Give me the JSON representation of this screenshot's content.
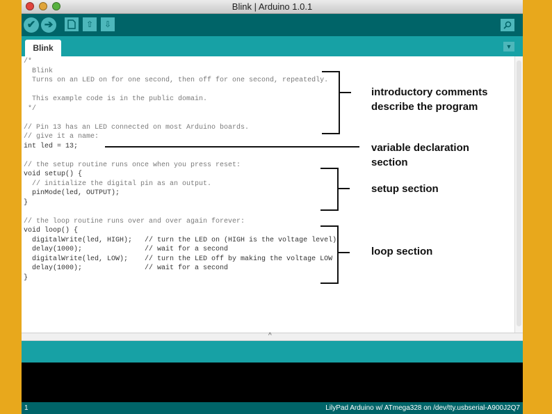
{
  "window": {
    "title": "Blink | Arduino 1.0.1"
  },
  "toolbar": {
    "verify_icon": "✔",
    "upload_icon": "➔",
    "new_icon": "📄",
    "open_icon": "⇧",
    "save_icon": "⇩",
    "serial_icon": "🔍"
  },
  "tabs": [
    {
      "label": "Blink"
    }
  ],
  "tab_menu_icon": "▼",
  "code_lines": [
    "/*",
    "  Blink",
    "  Turns on an LED on for one second, then off for one second, repeatedly.",
    "",
    "  This example code is in the public domain.",
    " */",
    "",
    "// Pin 13 has an LED connected on most Arduino boards.",
    "// give it a name:",
    "int led = 13;",
    "",
    "// the setup routine runs once when you press reset:",
    "void setup() {",
    "  // initialize the digital pin as an output.",
    "  pinMode(led, OUTPUT);",
    "}",
    "",
    "// the loop routine runs over and over again forever:",
    "void loop() {",
    "  digitalWrite(led, HIGH);   // turn the LED on (HIGH is the voltage level)",
    "  delay(1000);               // wait for a second",
    "  digitalWrite(led, LOW);    // turn the LED off by making the voltage LOW",
    "  delay(1000);               // wait for a second",
    "}"
  ],
  "annotations": {
    "intro": "introductory comments\ndescribe the program",
    "variable": "variable declaration\nsection",
    "setup": "setup section",
    "loop": "loop section"
  },
  "divider_handle": "^",
  "status": {
    "line_number": "1",
    "board": "LilyPad Arduino w/ ATmega328 on /dev/tty.usbserial-A900J2Q7"
  },
  "colors": {
    "background": "#e8a81c",
    "toolbar": "#006468",
    "tabbar": "#17a1a5",
    "button": "#4db7bb",
    "console": "#000000"
  }
}
